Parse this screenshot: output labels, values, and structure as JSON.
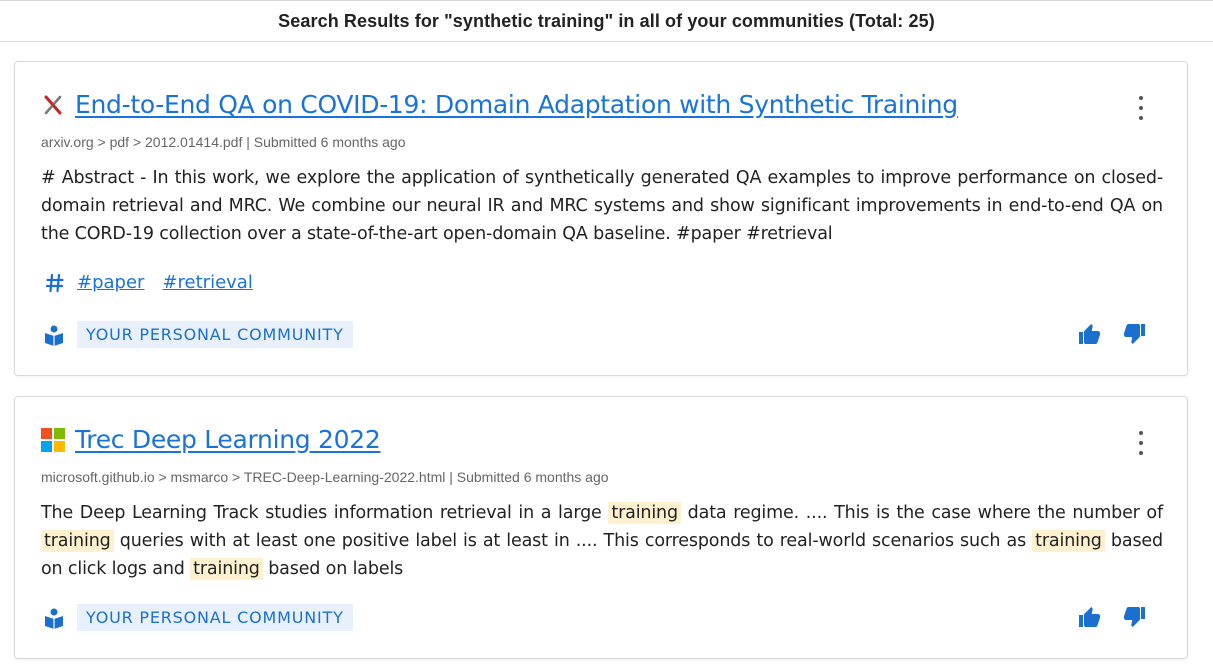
{
  "header": {
    "title": "Search Results for \"synthetic training\" in all of your communities (Total: 25)"
  },
  "colors": {
    "link": "#1a73d9",
    "highlight": "#fdf1d0",
    "badge_bg": "#e8f1fb"
  },
  "results": [
    {
      "favicon": "arxiv-x-icon",
      "title": "End-to-End QA on COVID-19: Domain Adaptation with Synthetic Training",
      "meta": "arxiv.org > pdf > 2012.01414.pdf | Submitted 6 months ago",
      "body": "# Abstract - In this work, we explore the application of synthetically generated QA examples to improve performance on closed-domain retrieval and MRC. We combine our neural IR and MRC systems and show significant improvements in end-to-end QA on the CORD-19 collection over a state-of-the-art open-domain QA baseline. #paper #retrieval",
      "tags": [
        "#paper",
        "#retrieval"
      ],
      "community": "YOUR PERSONAL COMMUNITY"
    },
    {
      "favicon": "microsoft-logo-icon",
      "title": "Trec Deep Learning 2022",
      "meta": "microsoft.github.io > msmarco > TREC-Deep-Learning-2022.html | Submitted 6 months ago",
      "body_parts": [
        "The Deep Learning Track studies information retrieval in a large ",
        "training",
        " data regime. .... This is the case where the number of ",
        "training",
        " queries with at least one positive label is at least in .... This corresponds to real-world scenarios such as ",
        "training",
        " based on click logs and ",
        "training",
        " based on labels"
      ],
      "community": "YOUR PERSONAL COMMUNITY"
    }
  ]
}
